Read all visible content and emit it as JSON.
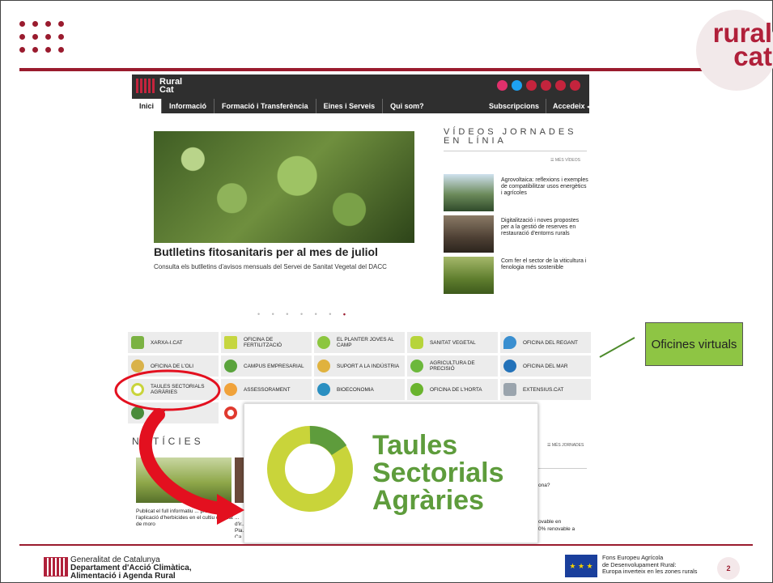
{
  "slide": {
    "logo_text_1": "rural",
    "logo_text_2": "cat",
    "page_number": "2",
    "callout": "Oficines virtuals",
    "footer": {
      "gencat_line1": "Generalitat de Catalunya",
      "gencat_line2": "Departament d'Acció Climàtica,",
      "gencat_line3": "Alimentació i Agenda Rural",
      "feader_line1": "Fons Europeu Agrícola",
      "feader_line2": "de Desenvolupament Rural:",
      "feader_line3": "Europa inverteix en les zones rurals"
    },
    "accent": "#9a1b2e"
  },
  "site": {
    "brand_1": "Rural",
    "brand_2": "Cat",
    "menu": [
      "Inici",
      "Informació",
      "Formació i Transferència",
      "Eines i Serveis",
      "Qui som?"
    ],
    "menu_right": [
      "Subscripcions",
      "Accedeix ⮐"
    ],
    "social_icons": [
      "instagram-icon",
      "twitter-icon",
      "facebook-icon",
      "youtube-icon",
      "mail-icon",
      "rss-icon"
    ],
    "hero": {
      "title": "Butlletins fitosanitaris per al mes de juliol",
      "subtitle": "Consulta els butlletins d'avisos mensuals del Servei de Sanitat Vegetal del DACC"
    },
    "videos": {
      "heading": "VÍDEOS JORNADES EN LÍNIA",
      "more": "☰ MÉS VÍDEOS",
      "items": [
        "Agrovoltaica: reflexions i exemples de compatibilitzar usos energètics i agrícoles",
        "Digitalització i noves propostes per a la gestió de reserves en restauració d'entorns rurals",
        "Com fer el sector de la viticultura i fenologia més sostenible"
      ]
    },
    "tiles": [
      "XARXA-I.CAT",
      "OFICINA DE FERTILITZACIÓ",
      "EL PLANTER JOVES AL CAMP",
      "SANITAT VEGETAL",
      "OFICINA DEL REGANT",
      "OFICINA DE L'OLI",
      "CAMPUS EMPRESARIAL",
      "SUPORT A LA INDÚSTRIA",
      "AGRICULTURA DE PRECISIÓ",
      "OFICINA DEL MAR",
      "TAULES SECTORIALS AGRÀRIES",
      "ASSESSORAMENT",
      "BIOECONOMIA",
      "OFICINA DE L'HORTA",
      "EXTENSIUS.CAT",
      "...NET",
      ""
    ],
    "noticies_heading": "NOTÍCIES",
    "more_jornades": "☰ MÉS JORNADES",
    "news": [
      "Publicat el full informatiu ... pràctiques en l'aplicació d'herbicides en el cultiu del blat de moro",
      "Es ... d'ir... Pla... Ca..."
    ],
    "right_snips": [
      "ona?",
      "ovable en",
      "0% renovable a"
    ]
  },
  "overlay": {
    "title_1": "Taules",
    "title_2": "Sectorials",
    "title_3": "Agràries"
  }
}
